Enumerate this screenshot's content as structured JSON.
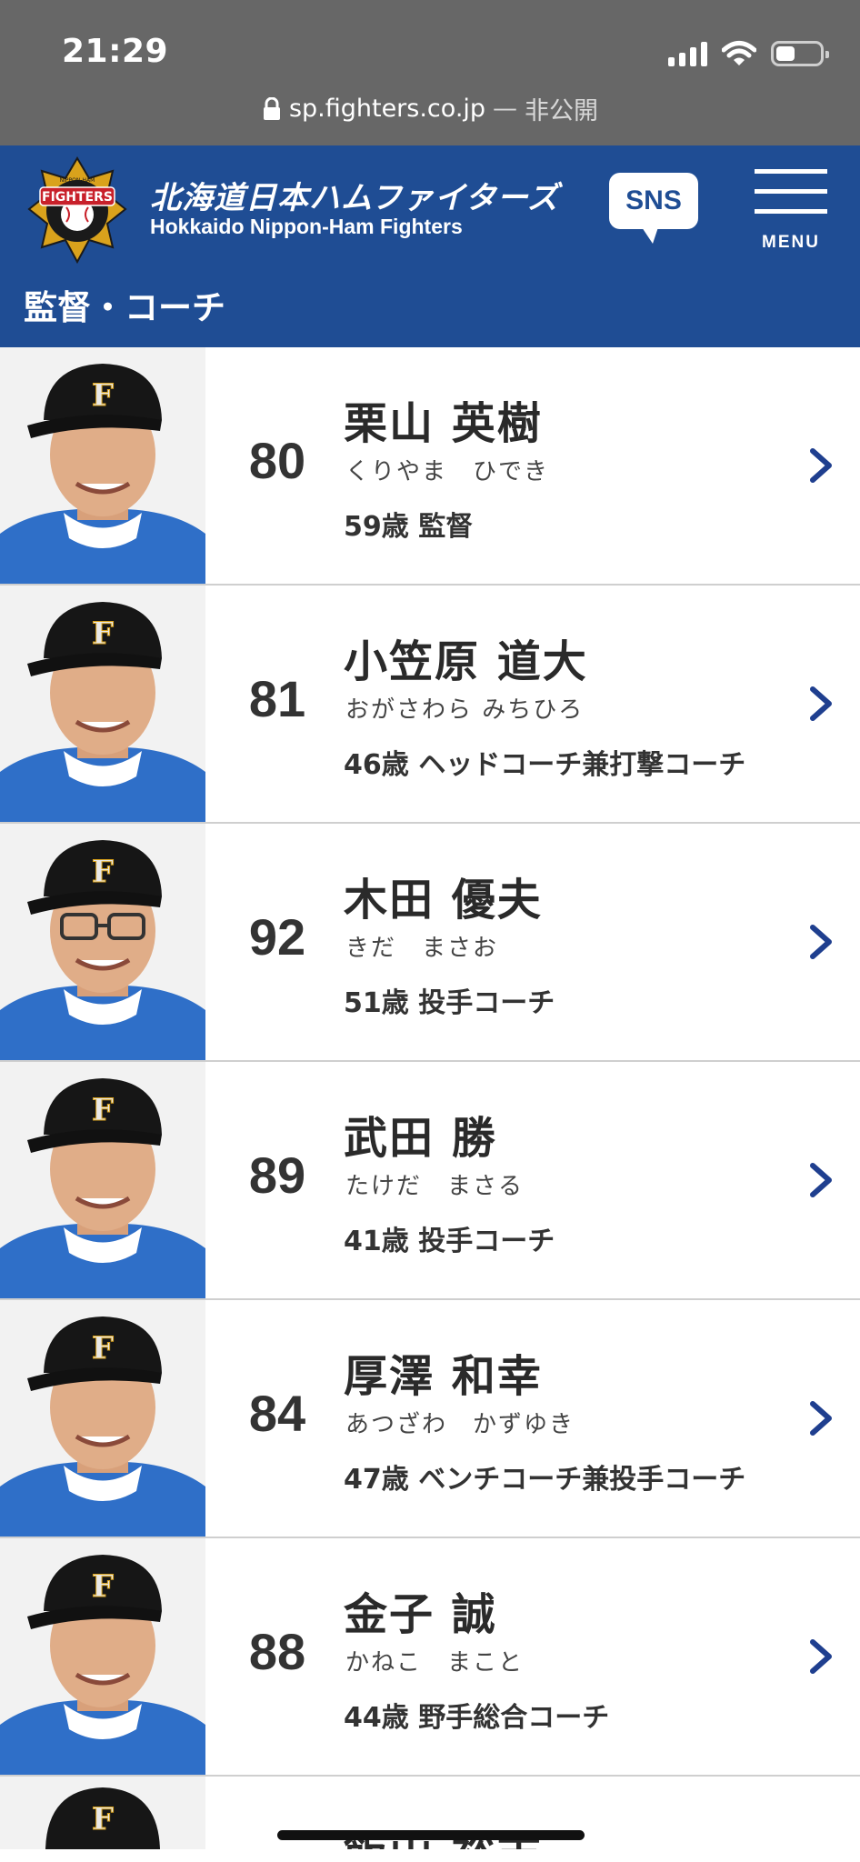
{
  "status_bar": {
    "time": "21:29",
    "url": "sp.fighters.co.jp",
    "separator": "—",
    "privacy": "非公開"
  },
  "header": {
    "logo_text_top": "NIPPON-HAM",
    "logo_text": "FIGHTERS",
    "brand_jp": "北海道日本ハムファイターズ",
    "brand_en": "Hokkaido Nippon-Ham Fighters",
    "sns_label": "SNS",
    "menu_label": "MENU"
  },
  "section_title": "監督・コーチ",
  "coaches": [
    {
      "number": "80",
      "name": "栗山 英樹",
      "kana": "くりやま　ひでき",
      "role": "59歳 監督"
    },
    {
      "number": "81",
      "name": "小笠原 道大",
      "kana": "おがさわら みちひろ",
      "role": "46歳 ヘッドコーチ兼打撃コーチ"
    },
    {
      "number": "92",
      "name": "木田 優夫",
      "kana": "きだ　まさお",
      "role": "51歳 投手コーチ"
    },
    {
      "number": "89",
      "name": "武田 勝",
      "kana": "たけだ　まさる",
      "role": "41歳 投手コーチ"
    },
    {
      "number": "84",
      "name": "厚澤 和幸",
      "kana": "あつざわ　かずゆき",
      "role": "47歳 ベンチコーチ兼投手コーチ"
    },
    {
      "number": "88",
      "name": "金子 誠",
      "kana": "かねこ　まこと",
      "role": "44歳 野手総合コーチ"
    }
  ],
  "partial_coach": {
    "name": "飯山 裕志"
  },
  "colors": {
    "header_blue": "#1f4d94",
    "status_gray": "#676767",
    "chevron_blue": "#1f3f8f"
  },
  "icons": {
    "lock": "lock-icon",
    "signal": "cellular-signal-icon",
    "wifi": "wifi-icon",
    "battery": "battery-icon",
    "chevron": "chevron-right-icon",
    "menu": "hamburger-menu-icon"
  }
}
